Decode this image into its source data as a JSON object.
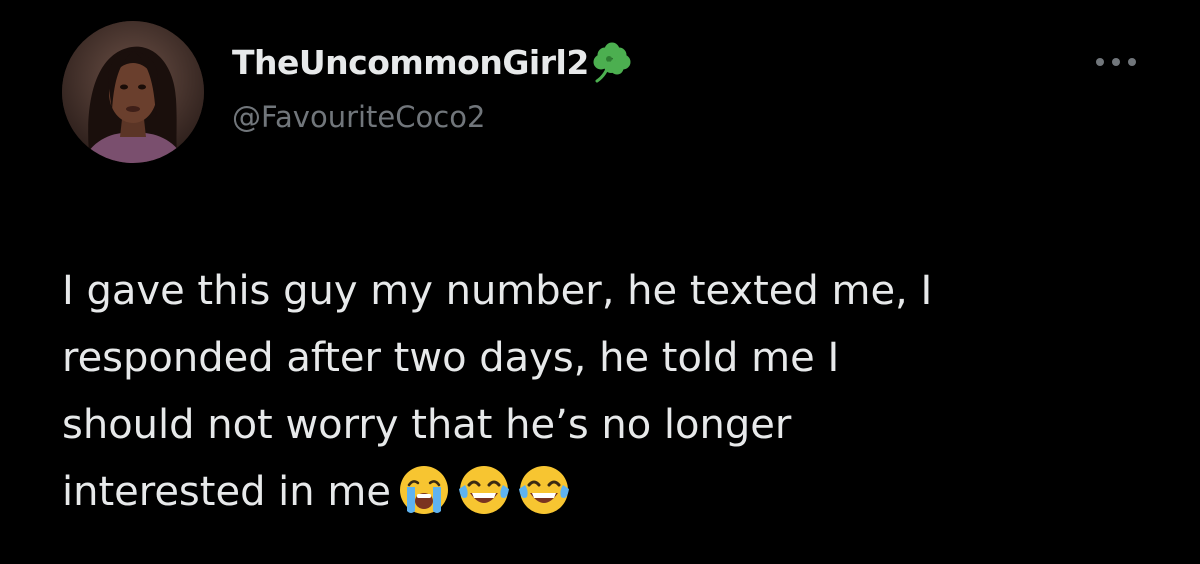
{
  "author": {
    "display_name": "TheUncommonGirl2",
    "handle": "@FavouriteCoco2",
    "name_badge_icon": "shamrock-icon",
    "avatar_icon": "profile-photo"
  },
  "actions": {
    "more_icon": "ellipsis-icon"
  },
  "tweet": {
    "lines": [
      "I gave this guy my number, he texted me, I",
      "responded after two days, he told me I",
      "should not worry that he’s no longer",
      "interested in me"
    ],
    "emojis": [
      "loudly-crying-face",
      "face-with-tears-of-joy",
      "face-with-tears-of-joy"
    ]
  },
  "colors": {
    "background": "#000000",
    "primary_text": "#e7e9ea",
    "secondary_text": "#71767b",
    "shamrock": "#4caf50"
  }
}
